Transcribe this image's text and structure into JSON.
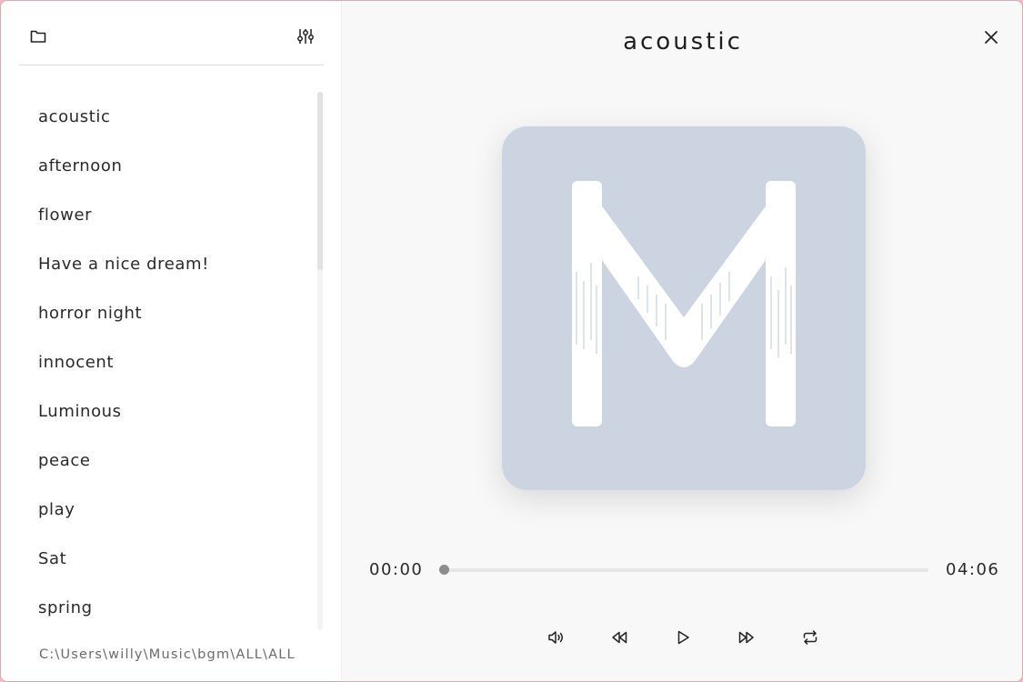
{
  "sidebar": {
    "songs": [
      {
        "label": "acoustic"
      },
      {
        "label": "afternoon"
      },
      {
        "label": "flower"
      },
      {
        "label": "Have a nice dream!"
      },
      {
        "label": "horror night"
      },
      {
        "label": "innocent"
      },
      {
        "label": "Luminous"
      },
      {
        "label": "peace"
      },
      {
        "label": "play"
      },
      {
        "label": "Sat"
      },
      {
        "label": "spring"
      }
    ],
    "folder_path": "C:\\Users\\willy\\Music\\bgm\\ALL\\ALL",
    "icons": {
      "folder": "folder-icon",
      "equalizer": "equalizer-icon"
    }
  },
  "player": {
    "title": "acoustic",
    "cover_icon": "m-logo-icon",
    "current_time": "00:00",
    "total_time": "04:06",
    "progress": 0.0,
    "controls": {
      "volume": "volume-icon",
      "previous": "rewind-icon",
      "play": "play-icon",
      "next": "fast-forward-icon",
      "repeat": "repeat-icon",
      "close": "close-icon"
    }
  },
  "colors": {
    "cover_background": "#cbd4e0",
    "accent": "#8c8c8c"
  }
}
